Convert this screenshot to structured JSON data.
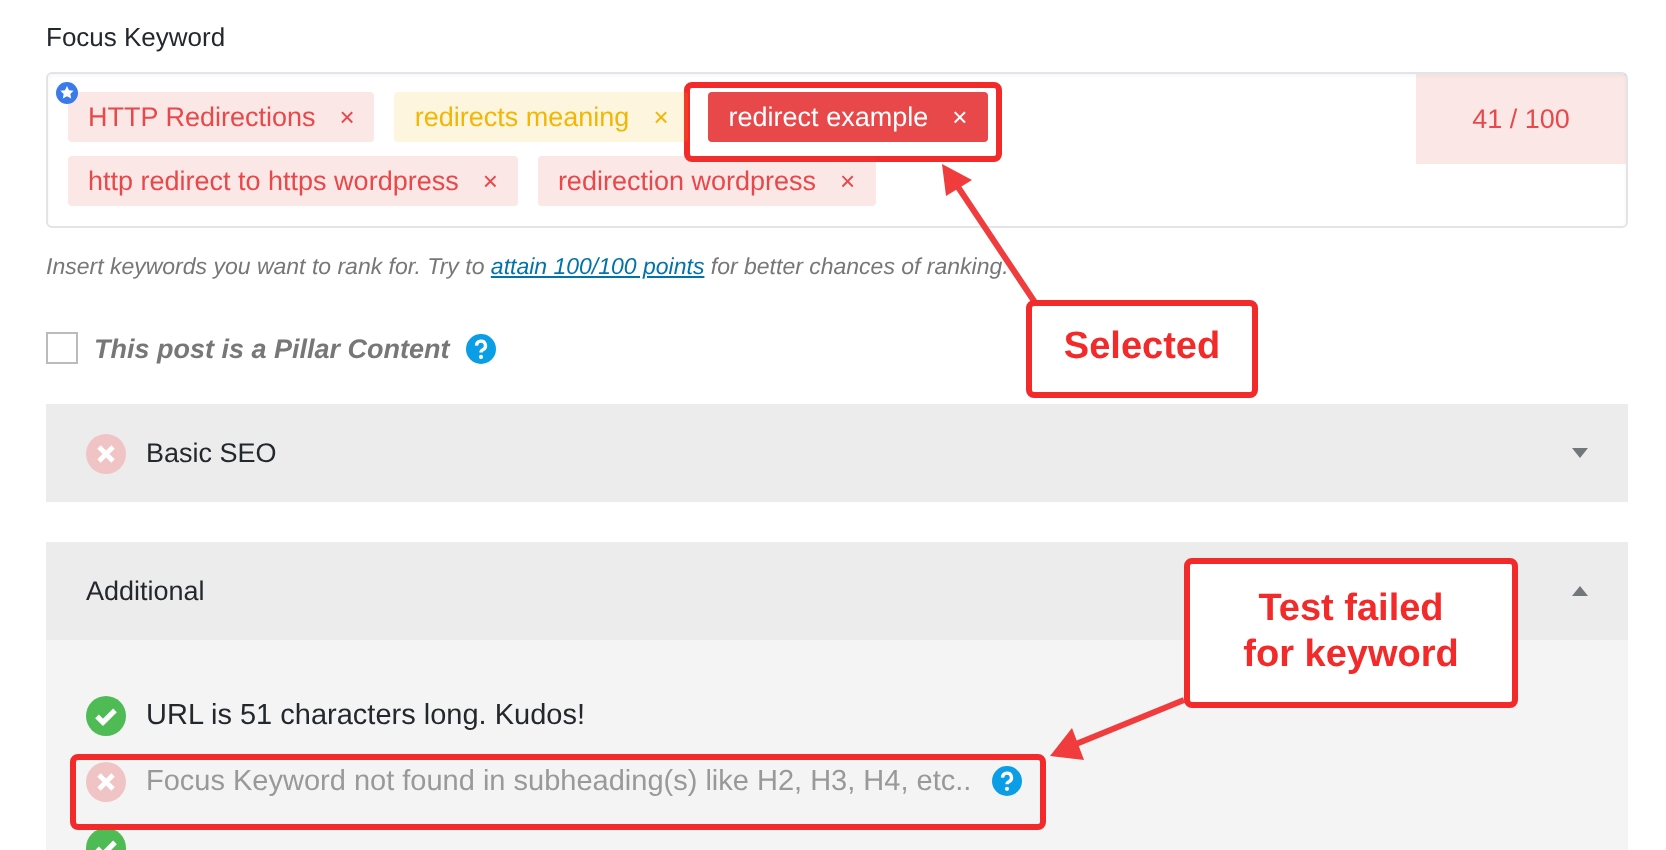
{
  "focus_keyword": {
    "label": "Focus Keyword",
    "keywords": [
      {
        "text": "HTTP Redirections",
        "color": "#e9484a",
        "selected": false,
        "primary": true
      },
      {
        "text": "redirects meaning",
        "color": "#f2b705",
        "selected": false,
        "primary": false
      },
      {
        "text": "redirect example",
        "color": "#e9484a",
        "selected": true,
        "primary": false
      },
      {
        "text": "http redirect to https wordpress",
        "color": "#e9484a",
        "selected": false,
        "primary": false
      },
      {
        "text": "redirection wordpress",
        "color": "#e9484a",
        "selected": false,
        "primary": false
      }
    ],
    "remove_glyph": "×",
    "score": {
      "text": "41 / 100",
      "color": "#e9484a"
    },
    "hint_before": "Insert keywords you want to rank for. Try to ",
    "hint_link": "attain 100/100 points",
    "hint_after": " for better chances of ranking."
  },
  "pillar": {
    "label": "This post is a Pillar Content",
    "checked": false
  },
  "sections": [
    {
      "title": "Basic SEO",
      "passed": false,
      "expanded": false
    },
    {
      "title": "Additional",
      "expanded": true,
      "tests": [
        {
          "text": "URL is 51 characters long. Kudos!",
          "passed": true,
          "help": false
        },
        {
          "text": "Focus Keyword not found in subheading(s) like H2, H3, H4, etc..",
          "passed": false,
          "help": true
        },
        {
          "passed": true,
          "help": false
        }
      ]
    }
  ],
  "annotations": [
    {
      "text": "Selected"
    },
    {
      "text": "Test failed for keyword"
    }
  ]
}
